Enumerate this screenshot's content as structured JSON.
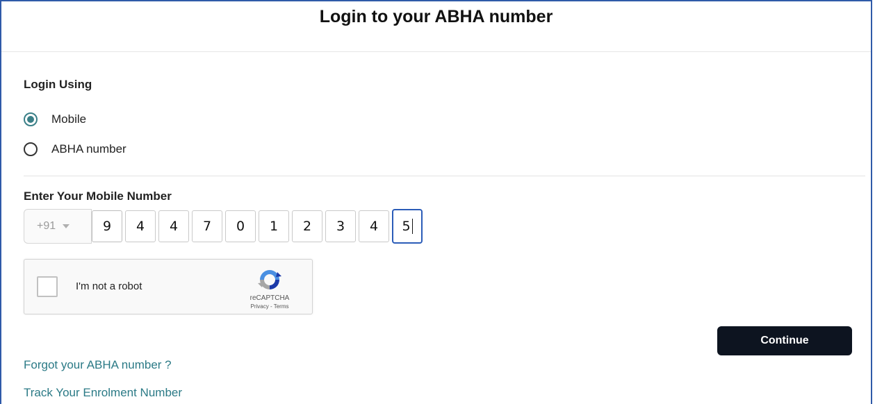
{
  "header": {
    "title": "Login to your ABHA number"
  },
  "login_using": {
    "label": "Login Using",
    "options": [
      {
        "label": "Mobile",
        "selected": true
      },
      {
        "label": "ABHA number",
        "selected": false
      }
    ]
  },
  "mobile": {
    "label": "Enter Your Mobile Number",
    "country_code": "+91",
    "digits": [
      "9",
      "4",
      "4",
      "7",
      "0",
      "1",
      "2",
      "3",
      "4",
      "5"
    ]
  },
  "recaptcha": {
    "label": "I'm not a robot",
    "brand": "reCAPTCHA",
    "links": "Privacy - Terms"
  },
  "actions": {
    "continue_label": "Continue"
  },
  "links": {
    "forgot": "Forgot your ABHA number ?",
    "track": "Track Your Enrolment Number"
  },
  "colors": {
    "accent": "#3a7f87",
    "link": "#2b7a86",
    "border_blue": "#2f5aa8",
    "button_bg": "#0d1420"
  }
}
